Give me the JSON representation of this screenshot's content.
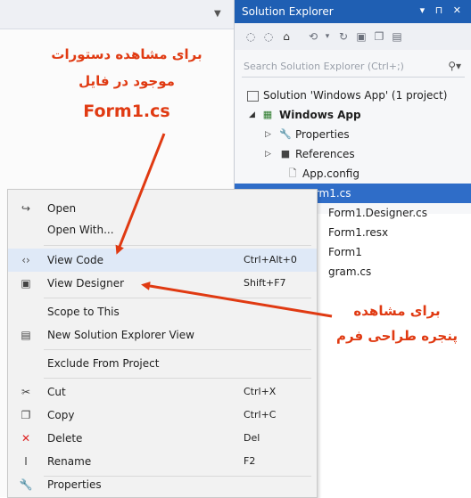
{
  "colors": {
    "accent": "#1f5fb3",
    "selection": "#2f6dc8",
    "annotation": "#e03a12"
  },
  "solution_explorer": {
    "title": "Solution Explorer",
    "title_controls": "▾ ⊓ ✕",
    "toolbar_icons": [
      "back-icon",
      "forward-icon",
      "home-icon",
      "sync-icon",
      "refresh-icon",
      "collapse-icon",
      "copy-icon",
      "show-all-icon"
    ],
    "search_placeholder": "Search Solution Explorer (Ctrl+;)",
    "tree": {
      "solution": "Solution 'Windows App' (1 project)",
      "project": "Windows App",
      "properties": "Properties",
      "references": "References",
      "appconfig": "App.config",
      "formcs": "Form1.cs",
      "designer": "Form1.Designer.cs",
      "resx": "Form1.resx",
      "form1": "Form1",
      "program": "gram.cs"
    }
  },
  "context_menu": {
    "items": [
      {
        "label": "Open",
        "shortcut": "",
        "icon": "open-icon"
      },
      {
        "label": "Open With...",
        "shortcut": "",
        "icon": ""
      },
      {
        "label": "View Code",
        "shortcut": "Ctrl+Alt+0",
        "icon": "code-icon"
      },
      {
        "label": "View Designer",
        "shortcut": "Shift+F7",
        "icon": "designer-icon"
      },
      {
        "label": "Scope to This",
        "shortcut": "",
        "icon": ""
      },
      {
        "label": "New Solution Explorer View",
        "shortcut": "",
        "icon": "new-view-icon"
      },
      {
        "label": "Exclude From Project",
        "shortcut": "",
        "icon": ""
      },
      {
        "label": "Cut",
        "shortcut": "Ctrl+X",
        "icon": "cut-icon"
      },
      {
        "label": "Copy",
        "shortcut": "Ctrl+C",
        "icon": "copy-icon"
      },
      {
        "label": "Delete",
        "shortcut": "Del",
        "icon": "delete-icon"
      },
      {
        "label": "Rename",
        "shortcut": "F2",
        "icon": "rename-icon"
      },
      {
        "label": "Properties",
        "shortcut": "",
        "icon": "properties-icon"
      }
    ]
  },
  "annotations": {
    "code": {
      "line1": "برای مشاهده دستورات",
      "line2": "موجود در فایل",
      "line3": "Form1.cs"
    },
    "designer": {
      "line1": "برای مشاهده",
      "line2": "پنجره طراحی فرم"
    }
  }
}
